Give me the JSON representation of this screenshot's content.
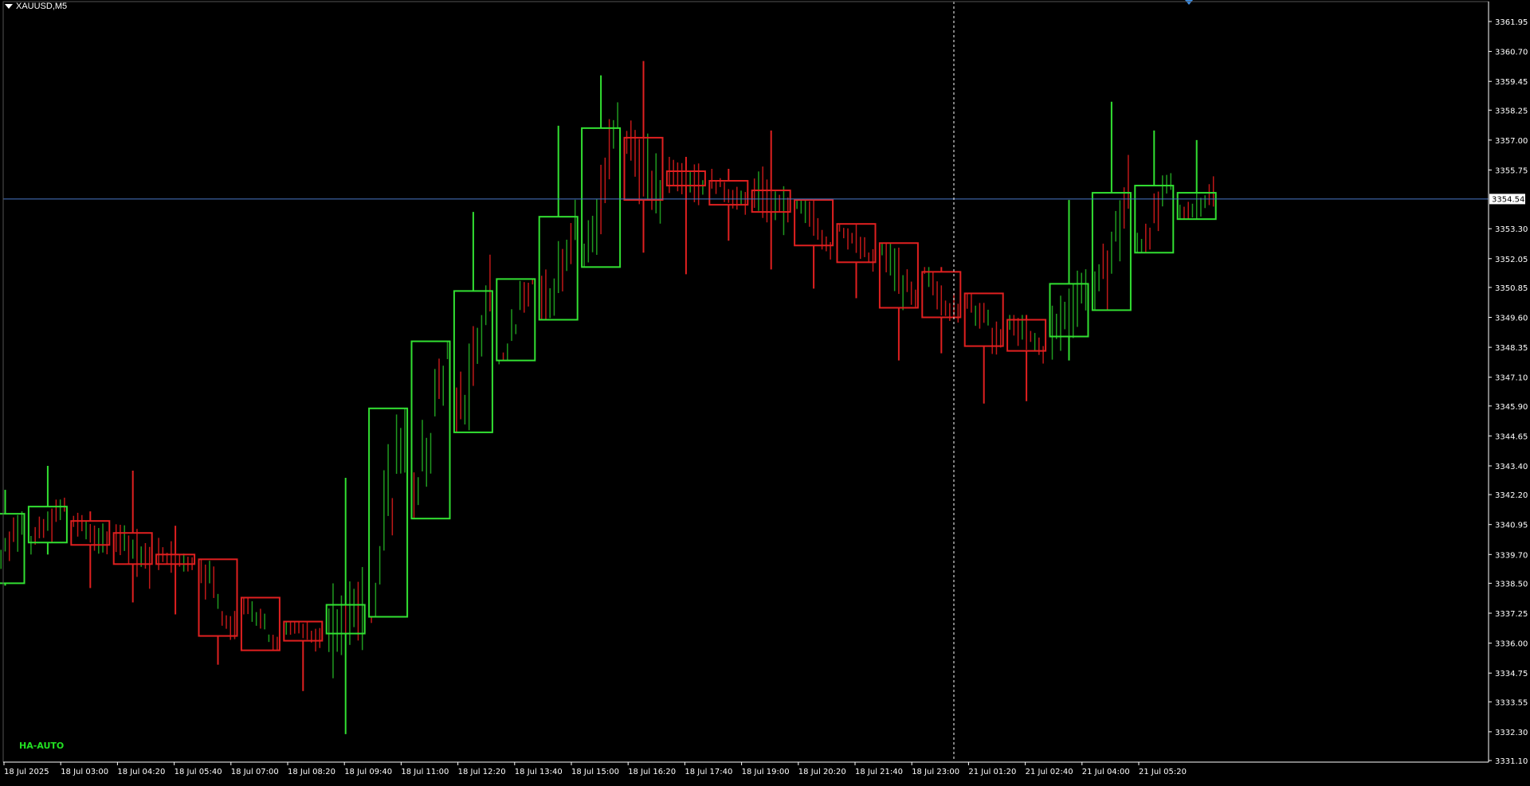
{
  "window": {
    "symbol_title": "XAUUSD,M5"
  },
  "indicator_label": "HA-AUTO",
  "colors": {
    "background": "#000000",
    "bull": "#32e032",
    "bear": "#e02020",
    "bull_tick": "#1f9a1f",
    "bear_tick": "#c01818",
    "price_line": "#4a78c8",
    "axis": "#ffffff",
    "label_green": "#22e022"
  },
  "chart_data": {
    "type": "candlestick",
    "price_axis": {
      "ticks": [
        "3361.95",
        "3360.70",
        "3359.45",
        "3358.25",
        "3357.00",
        "3355.75",
        "3353.30",
        "3352.05",
        "3350.85",
        "3349.60",
        "3348.35",
        "3347.10",
        "3345.90",
        "3344.65",
        "3343.40",
        "3342.20",
        "3340.95",
        "3339.70",
        "3338.50",
        "3337.25",
        "3336.00",
        "3334.75",
        "3333.55",
        "3332.30",
        "3331.10"
      ],
      "tick_values": [
        3361.95,
        3360.7,
        3359.45,
        3358.25,
        3357.0,
        3355.75,
        3353.3,
        3352.05,
        3350.85,
        3349.6,
        3348.35,
        3347.1,
        3345.9,
        3344.65,
        3343.4,
        3342.2,
        3340.95,
        3339.7,
        3338.5,
        3337.25,
        3336.0,
        3334.75,
        3333.55,
        3332.3,
        3331.1
      ],
      "range": [
        3330.95,
        3362.7
      ]
    },
    "current_price": {
      "value": 3354.54,
      "label": "3354.54"
    },
    "time_axis": {
      "labels": [
        "18 Jul 2025",
        "18 Jul 03:00",
        "18 Jul 04:20",
        "18 Jul 05:40",
        "18 Jul 07:00",
        "18 Jul 08:20",
        "18 Jul 09:40",
        "18 Jul 11:00",
        "18 Jul 12:20",
        "18 Jul 13:40",
        "18 Jul 15:00",
        "18 Jul 16:20",
        "18 Jul 17:40",
        "18 Jul 19:00",
        "18 Jul 20:20",
        "18 Jul 21:40",
        "18 Jul 23:00",
        "21 Jul 01:20",
        "21 Jul 02:40",
        "21 Jul 04:00",
        "21 Jul 05:20"
      ]
    },
    "ha_candles": [
      {
        "o": 3338.5,
        "c": 3341.4,
        "h": 3342.4,
        "l": 3338.4,
        "dir": "up"
      },
      {
        "o": 3340.2,
        "c": 3341.7,
        "h": 3343.4,
        "l": 3339.7,
        "dir": "up"
      },
      {
        "o": 3341.1,
        "c": 3340.1,
        "h": 3341.5,
        "l": 3338.3,
        "dir": "down"
      },
      {
        "o": 3340.6,
        "c": 3339.3,
        "h": 3343.2,
        "l": 3337.7,
        "dir": "down"
      },
      {
        "o": 3339.7,
        "c": 3339.3,
        "h": 3340.9,
        "l": 3337.2,
        "dir": "down"
      },
      {
        "o": 3339.5,
        "c": 3336.3,
        "h": 3339.5,
        "l": 3335.1,
        "dir": "down"
      },
      {
        "o": 3337.9,
        "c": 3335.7,
        "h": 3337.9,
        "l": 3335.7,
        "dir": "down"
      },
      {
        "o": 3336.9,
        "c": 3336.1,
        "h": 3336.9,
        "l": 3334.0,
        "dir": "down"
      },
      {
        "o": 3336.4,
        "c": 3337.6,
        "h": 3342.9,
        "l": 3332.2,
        "dir": "up"
      },
      {
        "o": 3337.1,
        "c": 3345.8,
        "h": 3345.8,
        "l": 3337.1,
        "dir": "up"
      },
      {
        "o": 3341.2,
        "c": 3348.6,
        "h": 3348.6,
        "l": 3341.2,
        "dir": "up"
      },
      {
        "o": 3344.8,
        "c": 3350.7,
        "h": 3354.0,
        "l": 3344.8,
        "dir": "up"
      },
      {
        "o": 3347.8,
        "c": 3351.2,
        "h": 3351.2,
        "l": 3347.8,
        "dir": "up"
      },
      {
        "o": 3349.5,
        "c": 3353.8,
        "h": 3357.6,
        "l": 3349.5,
        "dir": "up"
      },
      {
        "o": 3351.7,
        "c": 3357.5,
        "h": 3359.7,
        "l": 3351.7,
        "dir": "up"
      },
      {
        "o": 3357.1,
        "c": 3354.5,
        "h": 3360.3,
        "l": 3352.3,
        "dir": "down"
      },
      {
        "o": 3355.7,
        "c": 3355.1,
        "h": 3356.3,
        "l": 3351.4,
        "dir": "down"
      },
      {
        "o": 3355.3,
        "c": 3354.3,
        "h": 3355.8,
        "l": 3352.8,
        "dir": "down"
      },
      {
        "o": 3354.9,
        "c": 3354.0,
        "h": 3357.4,
        "l": 3351.6,
        "dir": "down"
      },
      {
        "o": 3354.5,
        "c": 3352.6,
        "h": 3354.5,
        "l": 3350.8,
        "dir": "down"
      },
      {
        "o": 3353.5,
        "c": 3351.9,
        "h": 3353.5,
        "l": 3350.4,
        "dir": "down"
      },
      {
        "o": 3352.7,
        "c": 3350.0,
        "h": 3352.7,
        "l": 3347.8,
        "dir": "down"
      },
      {
        "o": 3351.5,
        "c": 3349.6,
        "h": 3351.7,
        "l": 3348.1,
        "dir": "down"
      },
      {
        "o": 3350.6,
        "c": 3348.4,
        "h": 3350.6,
        "l": 3346.0,
        "dir": "down"
      },
      {
        "o": 3349.5,
        "c": 3348.2,
        "h": 3349.7,
        "l": 3346.1,
        "dir": "down"
      },
      {
        "o": 3348.8,
        "c": 3351.0,
        "h": 3354.5,
        "l": 3347.8,
        "dir": "up"
      },
      {
        "o": 3349.9,
        "c": 3354.8,
        "h": 3358.6,
        "l": 3349.9,
        "dir": "up"
      },
      {
        "o": 3352.3,
        "c": 3355.1,
        "h": 3357.4,
        "l": 3352.3,
        "dir": "up"
      },
      {
        "o": 3353.7,
        "c": 3354.8,
        "h": 3357.0,
        "l": 3353.7,
        "dir": "up"
      }
    ]
  }
}
